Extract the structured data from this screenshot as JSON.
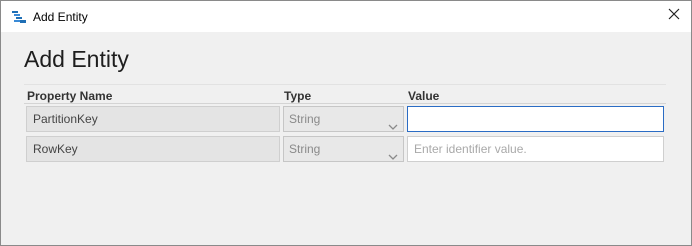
{
  "window": {
    "title": "Add Entity",
    "app_icon": "storage-explorer-icon",
    "close_icon": "close-icon"
  },
  "dialog": {
    "heading": "Add Entity",
    "columns": {
      "property_name": "Property Name",
      "type": "Type",
      "value": "Value"
    },
    "rows": [
      {
        "property": "PartitionKey",
        "type": "String",
        "value": "",
        "placeholder": ""
      },
      {
        "property": "RowKey",
        "type": "String",
        "value": "",
        "placeholder": "Enter identifier value."
      }
    ]
  },
  "colors": {
    "accent_focus": "#2b6cc4",
    "background": "#f0f0f0"
  }
}
